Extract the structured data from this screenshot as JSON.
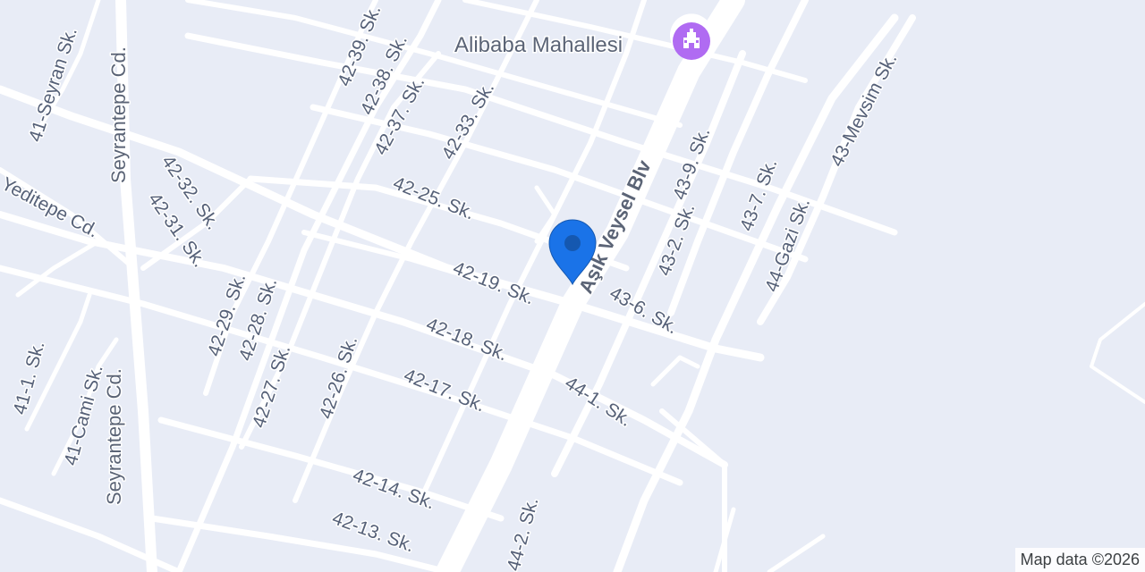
{
  "map": {
    "colors": {
      "background": "#e8ecf6",
      "road": "#ffffff",
      "label": "#566178",
      "pin": "#1a73e8",
      "poi": "#b06bf2"
    },
    "poi": {
      "name": "Alibaba Mahallesi",
      "icon": "landmark-icon"
    },
    "pin": {
      "icon": "location-pin-icon"
    },
    "street_labels": [
      "Aşık Veysel Blv",
      "Seyrantepe Cd.",
      "Seyrantepe Cd.",
      "Yeditepe Cd.",
      "41-Seyran Sk.",
      "41-1. Sk.",
      "41-Cami Sk.",
      "42-39. Sk.",
      "42-38. Sk.",
      "42-37. Sk.",
      "42-33. Sk.",
      "42-32. Sk.",
      "42-31. Sk.",
      "42-29. Sk.",
      "42-28. Sk.",
      "42-27. Sk.",
      "42-26. Sk.",
      "42-25. Sk.",
      "42-19. Sk.",
      "42-18. Sk.",
      "42-17. Sk.",
      "42-14. Sk.",
      "42-13. Sk.",
      "43-9. Sk.",
      "43-2. Sk.",
      "43-7. Sk.",
      "43-6. Sk.",
      "43-Mevsim Sk.",
      "44-Gazi Sk.",
      "44-1. Sk.",
      "44-2. Sk."
    ],
    "attribution": "Map data ©2026"
  }
}
